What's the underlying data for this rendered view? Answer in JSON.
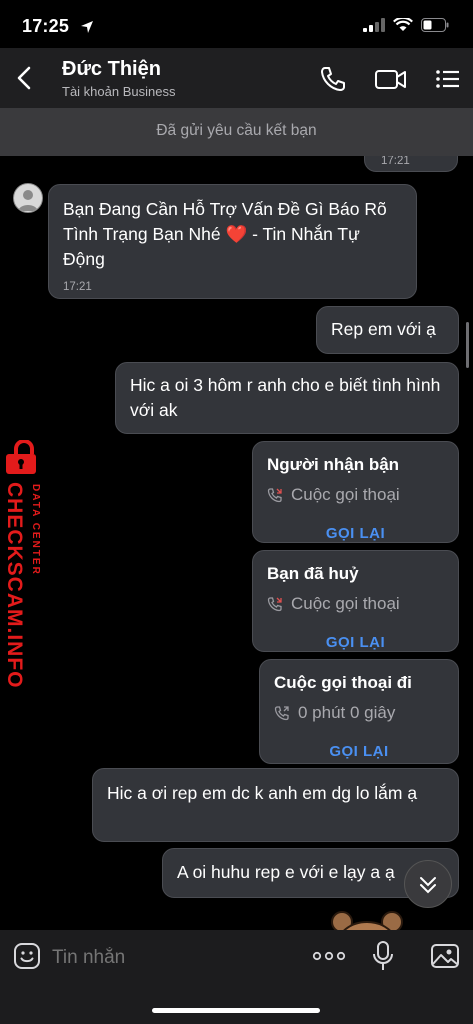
{
  "status": {
    "time": "17:25"
  },
  "header": {
    "title": "Đức Thiện",
    "subtitle": "Tài khoản Business"
  },
  "friend_request": "Đã gửi yêu cầu kết bạn",
  "messages": {
    "partial_ts": "17:21",
    "auto_reply": {
      "text": "Bạn Đang Cần Hỗ Trợ Vấn Đề Gì Báo Rõ Tình Trạng Bạn Nhé ❤️ - Tin Nhắn Tự Động",
      "time": "17:21"
    },
    "m1": "Rep em với ạ",
    "m2": "Hic a oi 3 hôm r anh cho e biết tình hình với ak",
    "call1": {
      "title": "Người nhận bận",
      "type": "Cuộc gọi thoại",
      "action": "GỌI LẠI"
    },
    "call2": {
      "title": "Bạn đã huỷ",
      "type": "Cuộc gọi thoại",
      "action": "GỌI LẠI"
    },
    "call3": {
      "title": "Cuộc gọi thoại đi",
      "type": "0 phút 0 giây",
      "action": "GỌI LẠI"
    },
    "m3": "Hic a ơi rep em dc k anh em dg lo lắm ạ",
    "m4": "A oi huhu rep e với e lạy a ạ"
  },
  "watermark": {
    "small": "DATA CENTER",
    "big": "CHECKSCAM.INFO"
  },
  "input": {
    "placeholder": "Tin nhắn"
  },
  "colors": {
    "accent": "#4a90f2",
    "watermark": "#e31b1b",
    "bubble": "#33353a"
  }
}
